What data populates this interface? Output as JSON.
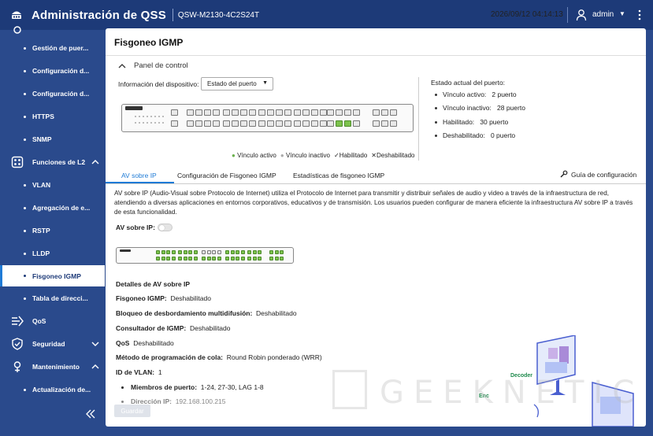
{
  "header": {
    "title": "Administración de QSS",
    "model": "QSW-M2130-4C2S24T",
    "datetime": "2026/09/12  04:14:13",
    "user": "admin"
  },
  "sidebar": {
    "items": [
      {
        "label": "Gestión de puer...",
        "type": "sub"
      },
      {
        "label": "Configuración d...",
        "type": "sub"
      },
      {
        "label": "Configuración d...",
        "type": "sub"
      },
      {
        "label": "HTTPS",
        "type": "sub"
      },
      {
        "label": "SNMP",
        "type": "sub"
      },
      {
        "label": "Funciones de L2",
        "type": "group",
        "icon": "layers-icon"
      },
      {
        "label": "VLAN",
        "type": "sub"
      },
      {
        "label": "Agregación de e...",
        "type": "sub"
      },
      {
        "label": "RSTP",
        "type": "sub"
      },
      {
        "label": "LLDP",
        "type": "sub"
      },
      {
        "label": "Fisgoneo IGMP",
        "type": "sub",
        "active": true
      },
      {
        "label": "Tabla de direcci...",
        "type": "sub"
      },
      {
        "label": "QoS",
        "type": "group",
        "icon": "qos-icon"
      },
      {
        "label": "Seguridad",
        "type": "group",
        "icon": "shield-icon"
      },
      {
        "label": "Mantenimiento",
        "type": "group",
        "icon": "wrench-icon"
      },
      {
        "label": "Actualización de...",
        "type": "sub"
      }
    ]
  },
  "page": {
    "title": "Fisgoneo IGMP",
    "panel_title": "Panel de control",
    "device_info_label": "Información del dispositivo:",
    "device_select_value": "Estado del puerto",
    "legend": {
      "active": "Vínculo activo",
      "inactive": "Vínculo inactivo",
      "enabled": "Habilitado",
      "disabled": "Deshabilitado"
    },
    "status": {
      "title": "Estado actual del puerto:",
      "rows": [
        {
          "label": "Vínculo activo:",
          "value": "2 puerto"
        },
        {
          "label": "Vínculo inactivo:",
          "value": "28 puerto"
        },
        {
          "label": "Habilitado:",
          "value": "30 puerto"
        },
        {
          "label": "Deshabilitado:",
          "value": "0 puerto"
        }
      ]
    },
    "tabs": [
      "AV sobre IP",
      "Configuración de Fisgoneo IGMP",
      "Estadísticas de fisgoneo IGMP"
    ],
    "guide": "Guía de configuración",
    "description": "AV sobre IP (Audio-Visual sobre Protocolo de Internet) utiliza el Protocolo de Internet para transmitir y distribuir señales de audio y video a través de la infraestructura de red, atendiendo a diversas aplicaciones en entornos corporativos, educativos y de transmisión. Los usuarios pueden configurar de manera eficiente la infraestructura AV sobre IP a través de esta funcionalidad.",
    "avip_label": "AV sobre IP:",
    "details_title": "Detalles de AV sobre IP",
    "details": [
      {
        "k": "Fisgoneo IGMP:",
        "v": "Deshabilitado"
      },
      {
        "k": "Bloqueo de desbordamiento multidifusión:",
        "v": "Deshabilitado"
      },
      {
        "k": "Consultador de IGMP:",
        "v": "Deshabilitado"
      },
      {
        "k": "QoS",
        "v": "Deshabilitado"
      },
      {
        "k": "Método de programación de cola:",
        "v": "Round Robin ponderado (WRR)"
      },
      {
        "k": "ID de VLAN:",
        "v": "1"
      }
    ],
    "members": {
      "k": "Miembros de puerto:",
      "v": "1-24,  27-30,  LAG  1-8"
    },
    "ip_partial": {
      "k": "Dirección IP:",
      "v": "192.168.100.215"
    },
    "save": "Guardar",
    "illus_decoder": "Decoder",
    "illus_encoder": "Enc",
    "watermark": "GEEKNETIC"
  }
}
